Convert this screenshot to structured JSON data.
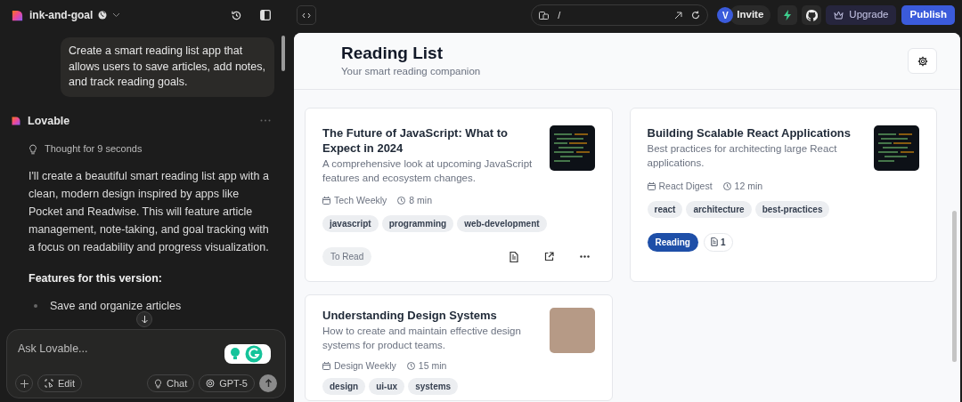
{
  "project": {
    "name": "ink-and-goal"
  },
  "chat": {
    "user_message": "Create a smart reading list app that allows users to save articles, add notes, and track reading goals.",
    "assistant": {
      "name": "Lovable",
      "thought": "Thought for 9 seconds",
      "paragraph": "I'll create a beautiful smart reading list app with a clean, modern design inspired by apps like Pocket and Readwise. This will feature article management, note-taking, and goal tracking with a focus on readability and progress visualization.",
      "heading": "Features for this version:",
      "bullets": [
        "Save and organize articles"
      ]
    },
    "input": {
      "placeholder": "Ask Lovable..."
    },
    "buttons": {
      "edit": "Edit",
      "chat": "Chat",
      "model": "GPT-5"
    }
  },
  "address_bar": {
    "path": "/"
  },
  "top_actions": {
    "avatar": "V",
    "invite": "Invite",
    "upgrade": "Upgrade",
    "publish": "Publish"
  },
  "preview": {
    "title": "Reading List",
    "subtitle": "Your smart reading companion",
    "articles": [
      {
        "title": "The Future of JavaScript: What to Expect in 2024",
        "summary": "A comprehensive look at upcoming JavaScript features and ecosystem changes.",
        "source": "Tech Weekly",
        "time": "8 min",
        "tags": [
          "javascript",
          "programming",
          "web-development"
        ],
        "status": {
          "label": "To Read",
          "kind": "queued"
        },
        "thumbnail": {
          "kind": "code"
        },
        "actions": [
          {
            "kind": "notes"
          },
          {
            "kind": "open"
          },
          {
            "kind": "more"
          }
        ]
      },
      {
        "title": "Building Scalable React Applications",
        "summary": "Best practices for architecting large React applications.",
        "source": "React Digest",
        "time": "12 min",
        "tags": [
          "react",
          "architecture",
          "best-practices"
        ],
        "status": {
          "label": "Reading",
          "kind": "active"
        },
        "thumbnail": {
          "kind": "code"
        },
        "notes": "1"
      },
      {
        "title": "Understanding Design Systems",
        "summary": "How to create and maintain effective design systems for product teams.",
        "source": "Design Weekly",
        "time": "15 min",
        "tags": [
          "design",
          "ui-ux",
          "systems"
        ],
        "thumbnail": {
          "kind": "photo"
        }
      }
    ]
  }
}
